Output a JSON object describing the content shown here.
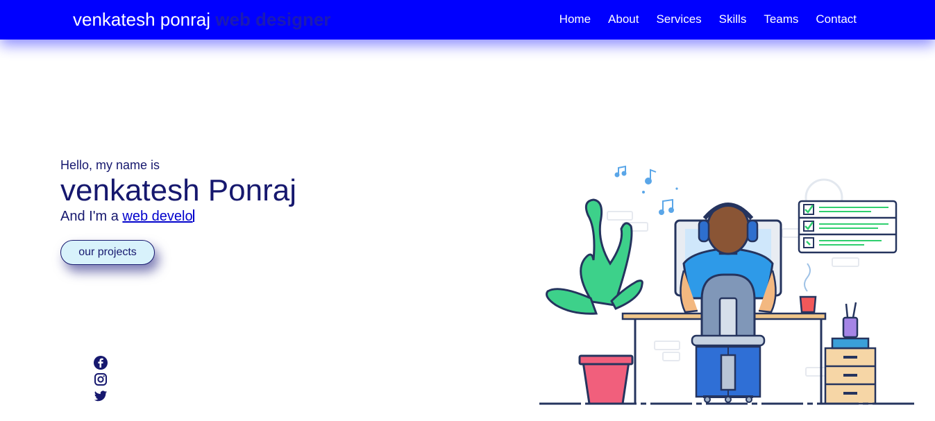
{
  "navbar": {
    "brand_name": "venkatesh ponraj",
    "brand_sub": "web designer",
    "links": [
      "Home",
      "About",
      "Services",
      "Skills",
      "Teams",
      "Contact"
    ]
  },
  "hero": {
    "greeting": "Hello, my name is",
    "name": "venkatesh Ponraj",
    "role_prefix": "And I'm a",
    "role_typed": "web develo",
    "cta_label": "our projects"
  },
  "social": [
    "facebook-icon",
    "instagram-icon",
    "twitter-icon"
  ],
  "colors": {
    "nav_bg": "#0000ff",
    "text_dark": "#16186e",
    "link": "#0000cc",
    "button_bg": "#d8f2fb"
  }
}
